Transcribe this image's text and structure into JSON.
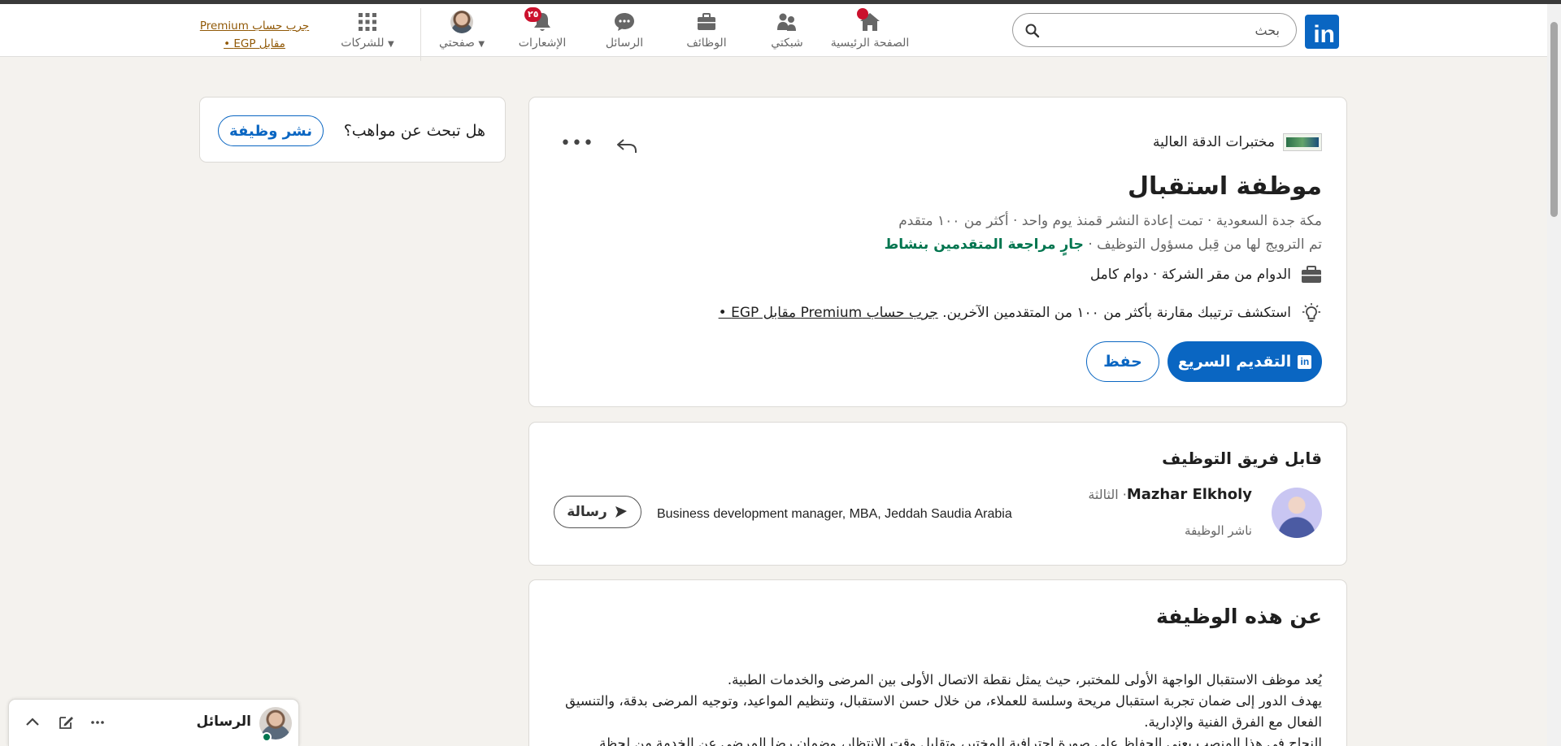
{
  "nav": {
    "search_placeholder": "بحث",
    "home_label": "الصفحة الرئيسية",
    "network_label": "شبكتي",
    "jobs_label": "الوظائف",
    "messaging_label": "الرسائل",
    "notifications_label": "الإشعارات",
    "notifications_badge": "٢٥",
    "me_label": "صفحتي",
    "business_label": "للشركات",
    "premium_line1": "جرب حساب Premium",
    "premium_line2": "مقابل EGP •",
    "icons": [
      "linkedin-logo",
      "search-icon",
      "home-icon",
      "network-icon",
      "jobs-icon",
      "messaging-icon",
      "bell-icon",
      "grid-icon"
    ]
  },
  "talent": {
    "question": "هل تبحث عن مواهب؟",
    "post_job": "نشر وظيفة"
  },
  "job": {
    "company": "مختبرات الدقة العالية",
    "title": "موظفة استقبال",
    "meta_line": "مكة جدة السعودية · تمت إعادة النشر قمنذ يوم واحد · أكثر من ١٠٠ متقدم",
    "promoted": "تم الترويج لها من قِبل مسؤول التوظيف · ",
    "active_review": "جارٍ مراجعة المتقدمين بنشاط",
    "workplace": "الدوام من مقر الشركة · دوام كامل",
    "insight_text": "استكشف ترتيبك مقارنة بأكثر من ١٠٠ من المتقدمين الآخرين. ",
    "insight_link": "جرب حساب Premium مقابل EGP •",
    "easy_apply": "التقديم السريع",
    "save": "حفظ",
    "more": "•••"
  },
  "hiring": {
    "heading": "قابل فريق التوظيف",
    "name": "Mazhar Elkholy",
    "degree": "· الثالثة",
    "role": "ناشر الوظيفة",
    "headline": "Business development manager, MBA, Jeddah Saudia Arabia",
    "message": "رسالة"
  },
  "about": {
    "heading": "عن هذه الوظيفة",
    "description": "يُعد موظف الاستقبال الواجهة الأولى للمختبر، حيث يمثل نقطة الاتصال الأولى بين المرضى والخدمات الطبية.\nيهدف الدور إلى ضمان تجربة استقبال مريحة وسلسة للعملاء، من خلال حسن الاستقبال، وتنظيم المواعيد، وتوجيه المرضى بدقة، والتنسيق الفعال مع الفرق الفنية والإدارية.\nالنجاح في هذا المنصب يعني الحفاظ على صورة احترافية للمختبر، وتقليل وقت الانتظار، وضمان رضا المرضى عن الخدمة من لحظة"
  },
  "messaging": {
    "title": "الرسائل"
  },
  "colors": {
    "brand": "#0a66c2",
    "active_green": "#01754f",
    "badge_red": "#cb112d",
    "premium_gold": "#915907",
    "background": "#f4f2ee"
  }
}
